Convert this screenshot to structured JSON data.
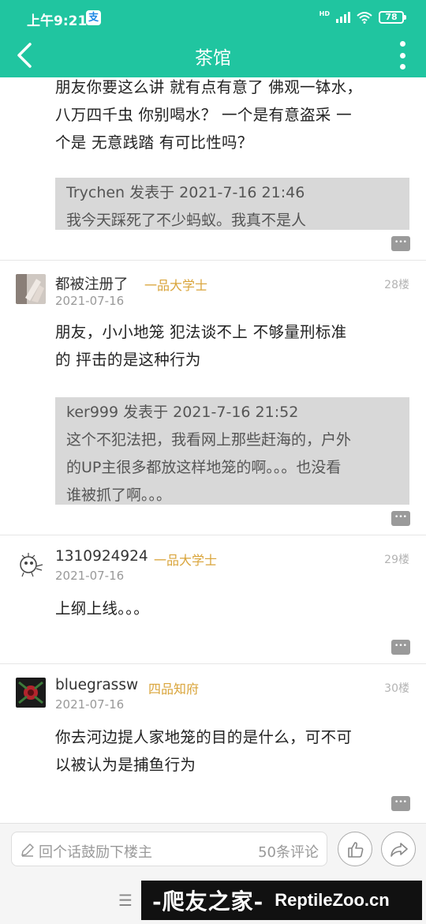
{
  "status_bar": {
    "time": "上午9:21",
    "alipay_glyph": "支",
    "network": "HD",
    "battery": "78"
  },
  "header": {
    "title": "茶馆",
    "back_icon": "chevron-left-icon",
    "menu_icon": "more-vertical-icon",
    "bg_color": "#20c5a0"
  },
  "posts": [
    {
      "lines": [
        "朋友你要这么讲 就有点有意了 佛观一钵水，",
        "八万四千虫 你别喝水？ 一个是有意盗采 一",
        "个是 无意践踏 有可比性吗？"
      ],
      "quote": [
        "Trychen 发表于 2021-7-16 21:46",
        "我今天踩死了不少蚂蚁。我真不是人"
      ]
    },
    {
      "username": "都被注册了",
      "rank": "一品大学士",
      "date": "2021-07-16",
      "floor": "28楼",
      "lines": [
        "朋友，小小地笼 犯法谈不上 不够量刑标准",
        "的 抨击的是这种行为"
      ],
      "quote": [
        "ker999 发表于 2021-7-16 21:52",
        "这个不犯法把，我看网上那些赶海的，户外",
        "的UP主很多都放这样地笼的啊。。。也没看",
        "谁被抓了啊。。。"
      ]
    },
    {
      "username": "1310924924",
      "rank": "一品大学士",
      "date": "2021-07-16",
      "floor": "29楼",
      "lines": [
        "上纲上线。。。"
      ]
    },
    {
      "username": "bluegrassw",
      "rank": "四品知府",
      "date": "2021-07-16",
      "floor": "30楼",
      "lines": [
        "你去河边提人家地笼的目的是什么，可不可",
        "以被认为是捕鱼行为"
      ]
    }
  ],
  "bottom_bar": {
    "placeholder": "回个话鼓励下楼主",
    "comment_count": "50条评论",
    "like_icon": "thumbs-up-icon",
    "share_icon": "share-icon"
  },
  "watermark": {
    "cn": "-爬友之家-",
    "en": "ReptileZoo.cn"
  }
}
